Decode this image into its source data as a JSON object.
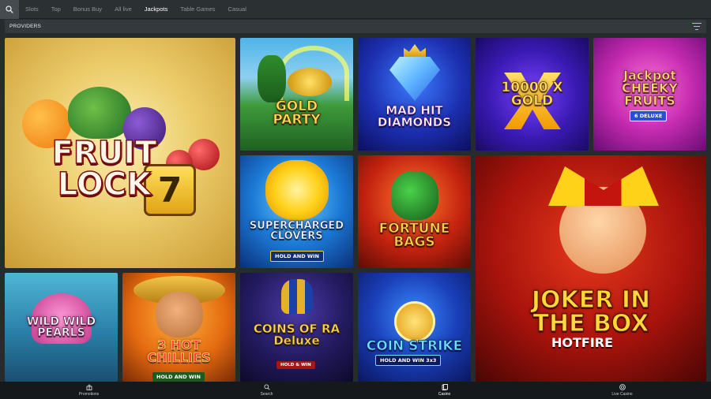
{
  "nav": {
    "tabs": [
      {
        "label": "Slots",
        "active": false
      },
      {
        "label": "Top",
        "active": false
      },
      {
        "label": "Bonus Buy",
        "active": false
      },
      {
        "label": "All live",
        "active": false
      },
      {
        "label": "Jackpots",
        "active": true
      },
      {
        "label": "Table Games",
        "active": false
      },
      {
        "label": "Casual",
        "active": false
      }
    ]
  },
  "providers": {
    "label": "PROVIDERS"
  },
  "colors": {
    "accent": "#f3c300",
    "background": "#262b2e",
    "bar": "#16191b"
  },
  "games": [
    {
      "title": "FRUIT LOCK",
      "badge": "7"
    },
    {
      "title": "GOLD PARTY"
    },
    {
      "title": "MAD HIT DIAMONDS"
    },
    {
      "title": "10000 X GOLD"
    },
    {
      "title": "Jackpot CHEEKY FRUITS",
      "sub": "6 DELUXE"
    },
    {
      "title": "SUPERCHARGED CLOVERS",
      "sub": "HOLD AND WIN"
    },
    {
      "title": "FORTUNE BAGS"
    },
    {
      "title": "JOKER IN THE BOX",
      "sub": "HOTFIRE"
    },
    {
      "title": "WILD WILD PEARLS"
    },
    {
      "title": "3 HOT CHILLIES",
      "sub": "HOLD AND WIN"
    },
    {
      "title": "COINS OF RA Deluxe",
      "sub": "HOLD & WIN"
    },
    {
      "title": "COIN STRIKE",
      "sub": "HOLD AND WIN 3x3"
    }
  ],
  "bottom_nav": [
    {
      "label": "Promotions",
      "icon": "gift-icon",
      "active": false
    },
    {
      "label": "Search",
      "icon": "search-icon",
      "active": false
    },
    {
      "label": "Casino",
      "icon": "cards-icon",
      "active": true
    },
    {
      "label": "Live Casino",
      "icon": "chip-icon",
      "active": false
    }
  ]
}
